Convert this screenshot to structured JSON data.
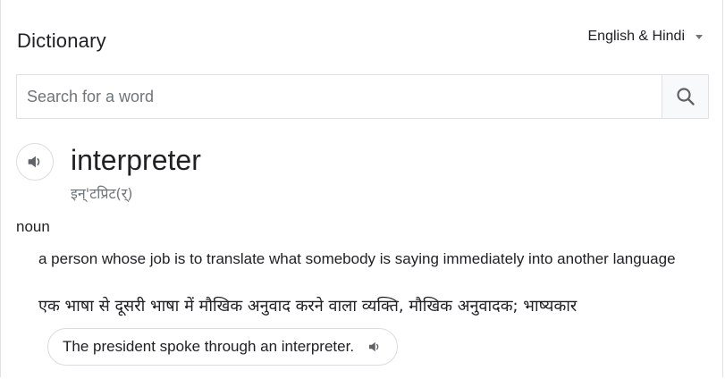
{
  "header": {
    "title": "Dictionary",
    "language": "English & Hindi"
  },
  "search": {
    "placeholder": "Search for a word",
    "value": ""
  },
  "entry": {
    "word": "interpreter",
    "phonetic": "इन्'टप्रिट(र्)",
    "part_of_speech": "noun",
    "definition_en": "a person whose job is to translate what somebody is saying immediately into another language",
    "definition_hi": "एक भाषा से दूसरी भाषा में मौखिक अनुवाद करने वाला व्यक्ति, मौखिक अनुवादक; भाष्यकार",
    "example": "The president spoke through an interpreter."
  },
  "icons": {
    "search": "search-icon",
    "pronounce": "speaker-icon",
    "dropdown": "caret-down-icon"
  },
  "colors": {
    "text": "#202124",
    "muted": "#70757a",
    "border": "#dfe1e5",
    "icon": "#5f6368"
  }
}
